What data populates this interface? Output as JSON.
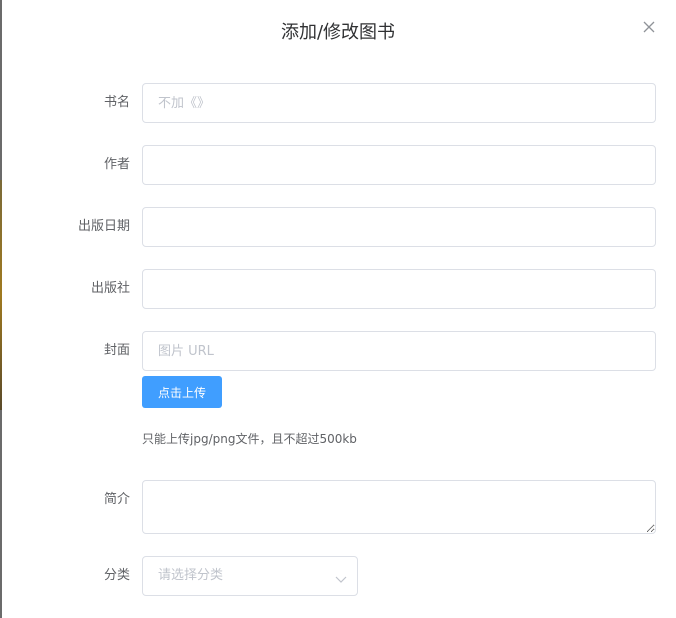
{
  "dialog": {
    "title": "添加/修改图书"
  },
  "form": {
    "title_label": "书名",
    "title_placeholder": "不加《》",
    "author_label": "作者",
    "date_label": "出版日期",
    "press_label": "出版社",
    "cover_label": "封面",
    "cover_placeholder": "图片 URL",
    "upload_button": "点击上传",
    "upload_tip": "只能上传jpg/png文件，且不超过500kb",
    "abs_label": "简介",
    "category_label": "分类",
    "category_placeholder": "请选择分类"
  },
  "colors": {
    "primary": "#409eff",
    "border": "#dcdfe6",
    "placeholder": "#c0c4cc",
    "label": "#606266",
    "title": "#303133"
  },
  "icons": {
    "close": "close-icon",
    "select_arrow": "chevron-down-icon"
  }
}
